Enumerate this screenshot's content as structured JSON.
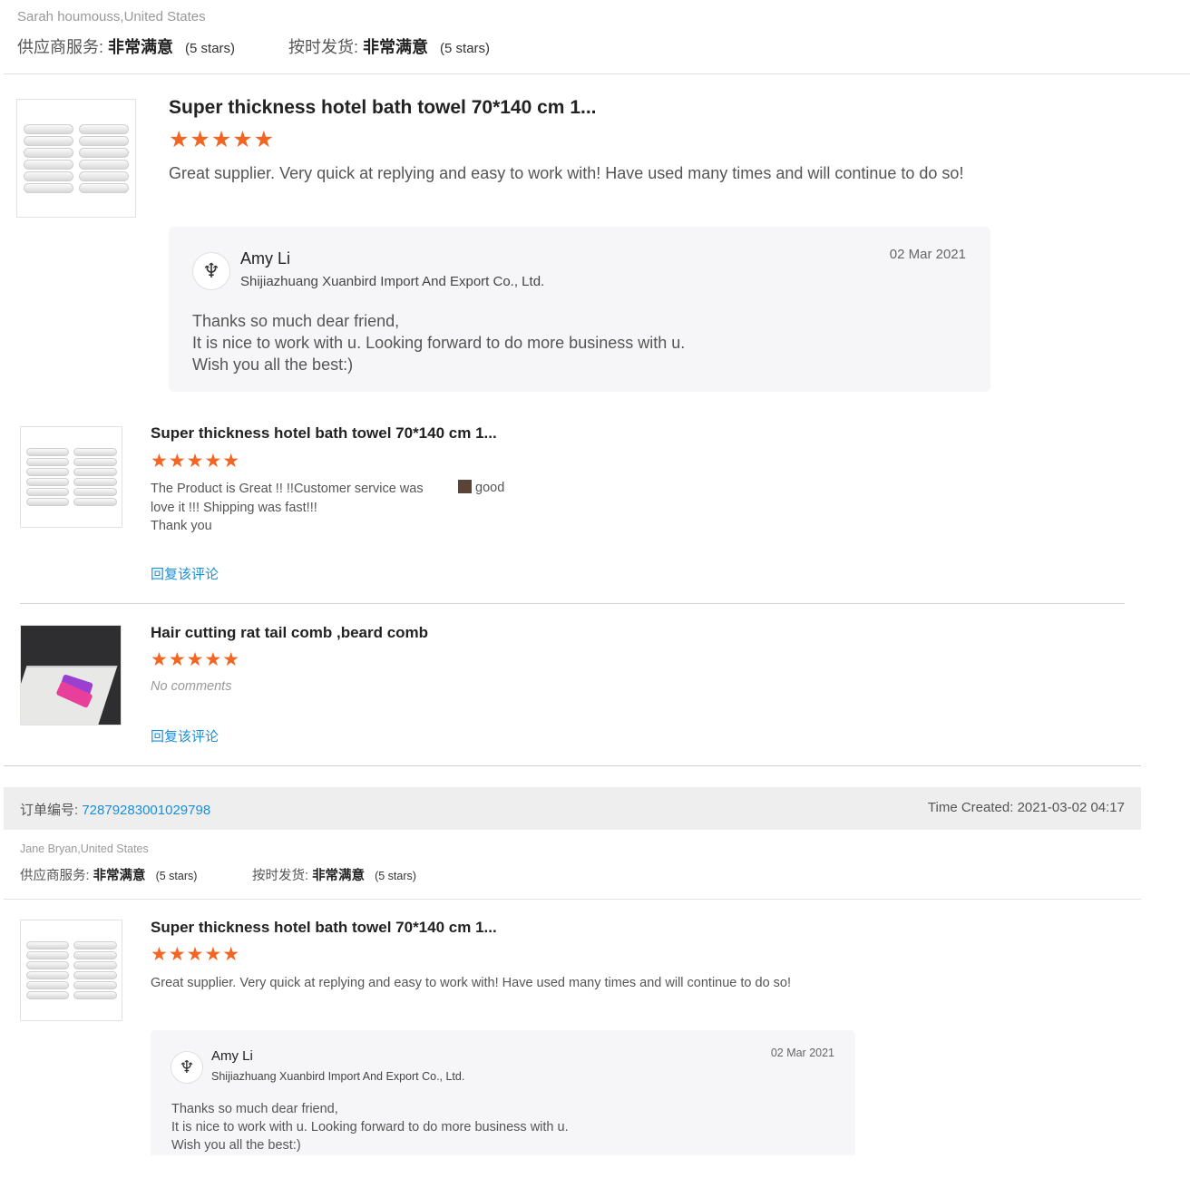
{
  "review1": {
    "buyer": "Sarah houmouss,United States",
    "service_label": "供应商服务:",
    "service_value": "非常满意",
    "service_stars": "(5 stars)",
    "shipping_label": "按时发货:",
    "shipping_value": "非常满意",
    "shipping_stars": "(5 stars)",
    "items": [
      {
        "title": "Super thickness hotel bath towel 70*140 cm 1...",
        "rating": 5,
        "stars": "★★★★★",
        "comment": "Great supplier. Very quick at replying and easy to work with! Have used many times and will continue to do so!",
        "reply": {
          "name": "Amy Li",
          "company": "Shijiazhuang Xuanbird Import And Export Co., Ltd.",
          "date": "02 Mar 2021",
          "lines": [
            "Thanks so much dear friend,",
            "It is nice to work with u. Looking forward to do more business with u.",
            "Wish you all the best:)"
          ]
        }
      },
      {
        "title": "Super thickness hotel bath towel 70*140 cm 1...",
        "rating": 5,
        "stars": "★★★★★",
        "comment_lines": [
          "The Product is Great !! !!Customer service was",
          "love it !!! Shipping was fast!!!",
          "Thank you"
        ],
        "attribute": "good",
        "reply_link": "回复该评论"
      },
      {
        "title": "Hair cutting rat tail comb ,beard comb",
        "rating": 5,
        "stars": "★★★★★",
        "comment": "No comments",
        "reply_link": "回复该评论"
      }
    ]
  },
  "order": {
    "label": "订单编号:",
    "number": "72879283001029798",
    "time_label": "Time Created:",
    "time_value": "2021-03-02 04:17"
  },
  "review2": {
    "buyer": "Jane Bryan,United States",
    "service_label": "供应商服务:",
    "service_value": "非常满意",
    "service_stars": "(5 stars)",
    "shipping_label": "按时发货:",
    "shipping_value": "非常满意",
    "shipping_stars": "(5 stars)",
    "item": {
      "title": "Super thickness hotel bath towel 70*140 cm 1...",
      "rating": 5,
      "stars": "★★★★★",
      "comment": "Great supplier. Very quick at replying and easy to work with! Have used many times and will continue to do so!",
      "reply": {
        "name": "Amy Li",
        "company": "Shijiazhuang Xuanbird Import And Export Co., Ltd.",
        "date": "02 Mar 2021",
        "lines": [
          "Thanks so much dear friend,",
          "It is nice to work with u. Looking forward to do more business with u.",
          "Wish you all the best:)"
        ]
      }
    }
  },
  "colors": {
    "star": "#f26522",
    "link": "#1a8fd8",
    "order_bar": "#eeeeee"
  },
  "icons": {
    "star": "star-icon",
    "avatar": "bird-logo-icon"
  }
}
